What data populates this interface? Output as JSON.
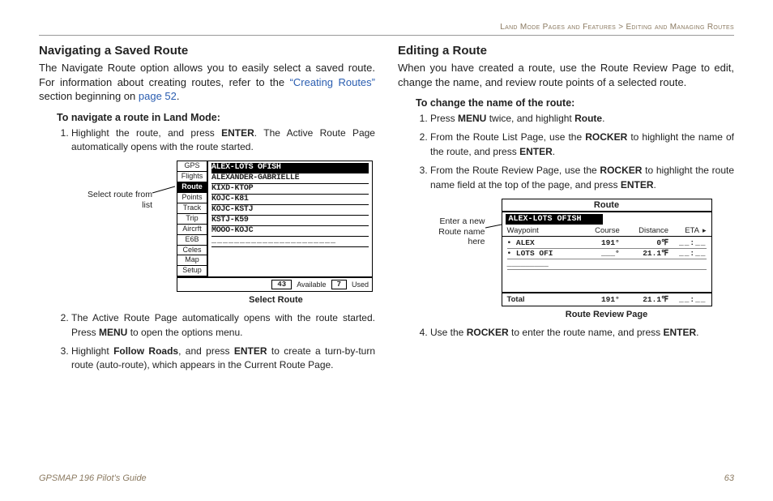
{
  "header": {
    "crumb_left": "Land Mode Pages and Features",
    "crumb_sep": " > ",
    "crumb_right": "Editing and Managing Routes"
  },
  "left_col": {
    "heading": "Navigating a Saved Route",
    "intro_a": "The Navigate Route option allows you to easily select a saved route. For information about creating routes, refer to the ",
    "intro_link1": "“Creating Routes”",
    "intro_b": " section beginning on ",
    "intro_link2": "page 52",
    "intro_c": ".",
    "subheading": "To navigate a route in Land Mode:",
    "step1_a": "Highlight the route, and press ",
    "step1_b": "ENTER",
    "step1_c": ". The Active Route Page automatically opens with the route started.",
    "step2_a": "The Active Route Page automatically opens with the route started. Press ",
    "step2_b": "MENU",
    "step2_c": " to open the options menu.",
    "step3_a": "Highlight ",
    "step3_b": "Follow Roads",
    "step3_c": ", and press ",
    "step3_d": "ENTER",
    "step3_e": " to create a turn-by-turn route (auto-route), which appears in the Current Route Page.",
    "fig": {
      "annotation": "Select route from list",
      "caption": "Select Route",
      "tabs": [
        "GPS",
        "Flights",
        "Route",
        "Points",
        "Track",
        "Trip",
        "Aircrft",
        "E6B",
        "Celes",
        "Map",
        "Setup"
      ],
      "sel_tab_index": 2,
      "routes": [
        "ALEX-LOTS OFISH",
        "ALEXANDER-GABRIELLE",
        "KIXD-KTOP",
        "KOJC-K81",
        "KOJC-KSTJ",
        "KSTJ-K59",
        "MOOO-KOJC"
      ],
      "sel_route_index": 0,
      "dash_row": "______________________",
      "avail_count": "43",
      "avail_label": "Available",
      "used_count": "7",
      "used_label": "Used"
    }
  },
  "right_col": {
    "heading": "Editing a Route",
    "intro": "When you have created a route, use the Route Review Page to edit, change the name, and review route points of a selected route.",
    "subheading": "To change the name of the route:",
    "step1_a": "Press ",
    "step1_b": "MENU",
    "step1_c": " twice, and highlight ",
    "step1_d": "Route",
    "step1_e": ".",
    "step2_a": "From the Route List Page, use the ",
    "step2_b": "ROCKER",
    "step2_c": " to highlight the name of the route, and press ",
    "step2_d": "ENTER",
    "step2_e": ".",
    "step3_a": "From the Route Review Page, use the ",
    "step3_b": "ROCKER",
    "step3_c": " to highlight the route name field at the top of the page, and press ",
    "step3_d": "ENTER",
    "step3_e": ".",
    "step4_a": "Use the ",
    "step4_b": "ROCKER",
    "step4_c": " to enter the route name, and press ",
    "step4_d": "ENTER",
    "step4_e": ".",
    "fig": {
      "annotation": "Enter a new Route name here",
      "caption": "Route Review Page",
      "title": "Route",
      "name_field": "ALEX-LOTS OFISH",
      "headers": [
        "Waypoint",
        "Course",
        "Distance",
        "ETA"
      ],
      "rows": [
        {
          "wp": "• ALEX",
          "course": "191°",
          "dist": "0℉",
          "eta": "__:__"
        },
        {
          "wp": "• LOTS OFI",
          "course": "___°",
          "dist": "21.1℉",
          "eta": "__:__"
        },
        {
          "wp": "_________",
          "course": "",
          "dist": "",
          "eta": ""
        }
      ],
      "total_label": "Total",
      "total_course": "191°",
      "total_dist": "21.1℉",
      "total_eta": "__:__"
    }
  },
  "footer": {
    "guide": "GPSMAP 196 Pilot’s Guide",
    "page": "63"
  }
}
